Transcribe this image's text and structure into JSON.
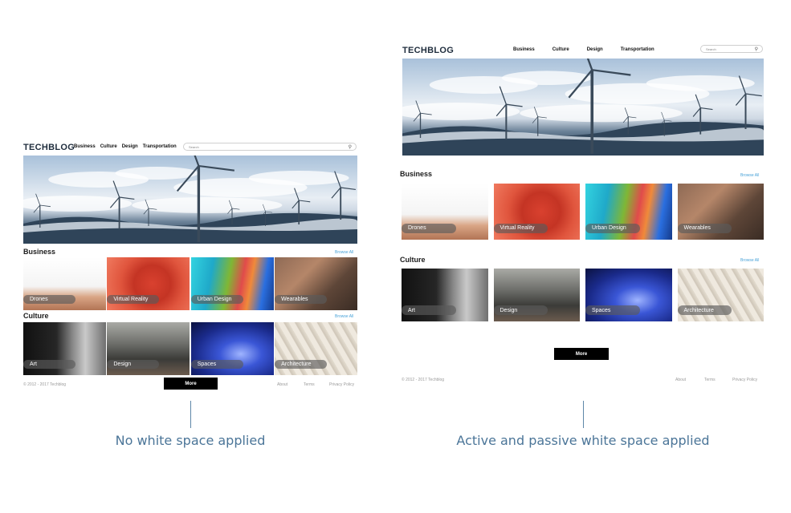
{
  "mockups": [
    {
      "id": "left",
      "logo": "TECHBLOG",
      "nav": [
        "Business",
        "Culture",
        "Design",
        "Transportation"
      ],
      "search_placeholder": "Search",
      "sections": [
        {
          "title": "Business",
          "browse": "Browse All",
          "tiles": [
            {
              "label": "Drones",
              "art": "t-drones"
            },
            {
              "label": "Virtual Reality",
              "art": "t-vr"
            },
            {
              "label": "Urban Design",
              "art": "t-urban"
            },
            {
              "label": "Wearables",
              "art": "t-wear"
            }
          ]
        },
        {
          "title": "Culture",
          "browse": "Browse All",
          "tiles": [
            {
              "label": "Art",
              "art": "t-art"
            },
            {
              "label": "Design",
              "art": "t-design"
            },
            {
              "label": "Spaces",
              "art": "t-spaces"
            },
            {
              "label": "Architecture",
              "art": "t-arch"
            }
          ]
        }
      ],
      "more": "More",
      "copyright": "© 2012 - 2017 Techblog",
      "footer_links": [
        "About",
        "Terms",
        "Privacy Policy"
      ]
    },
    {
      "id": "right",
      "logo": "TECHBLOG",
      "nav": [
        "Business",
        "Culture",
        "Design",
        "Transportation"
      ],
      "search_placeholder": "Search",
      "sections": [
        {
          "title": "Business",
          "browse": "Browse All",
          "tiles": [
            {
              "label": "Drones",
              "art": "t-drones"
            },
            {
              "label": "Virtual Reality",
              "art": "t-vr"
            },
            {
              "label": "Urban Design",
              "art": "t-urban"
            },
            {
              "label": "Wearables",
              "art": "t-wear"
            }
          ]
        },
        {
          "title": "Culture",
          "browse": "Browse All",
          "tiles": [
            {
              "label": "Art",
              "art": "t-art"
            },
            {
              "label": "Design",
              "art": "t-design"
            },
            {
              "label": "Spaces",
              "art": "t-spaces"
            },
            {
              "label": "Architecture",
              "art": "t-arch"
            }
          ]
        }
      ],
      "more": "More",
      "copyright": "© 2012 - 2017 Techblog",
      "footer_links": [
        "About",
        "Terms",
        "Privacy Policy"
      ]
    }
  ],
  "captions": {
    "left": "No white space applied",
    "right": "Active and passive white space applied"
  },
  "colors": {
    "logo": "#1f2d3d",
    "browse_link": "#4aa3d8",
    "caption": "#4b7598",
    "more_button": "#000000"
  },
  "icons": {
    "search": "search-icon"
  }
}
